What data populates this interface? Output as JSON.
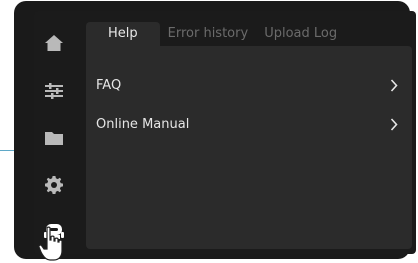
{
  "sidebar": {
    "items": [
      {
        "icon": "home-icon"
      },
      {
        "icon": "sliders-icon"
      },
      {
        "icon": "folder-icon"
      },
      {
        "icon": "gear-icon"
      },
      {
        "icon": "robot-icon",
        "active": true
      }
    ]
  },
  "tabs": [
    {
      "label": "Help",
      "active": true
    },
    {
      "label": "Error history",
      "active": false
    },
    {
      "label": "Upload Log",
      "active": false
    }
  ],
  "help_items": [
    {
      "label": "FAQ"
    },
    {
      "label": "Online Manual"
    }
  ],
  "colors": {
    "screen_bg": "#1b1b1b",
    "panel_bg": "#2b2b2b",
    "icon_gray": "#b9b9b9",
    "icon_active": "#ffffff",
    "text_inactive": "#6b6b6b",
    "text_active": "#e8e8e8"
  }
}
